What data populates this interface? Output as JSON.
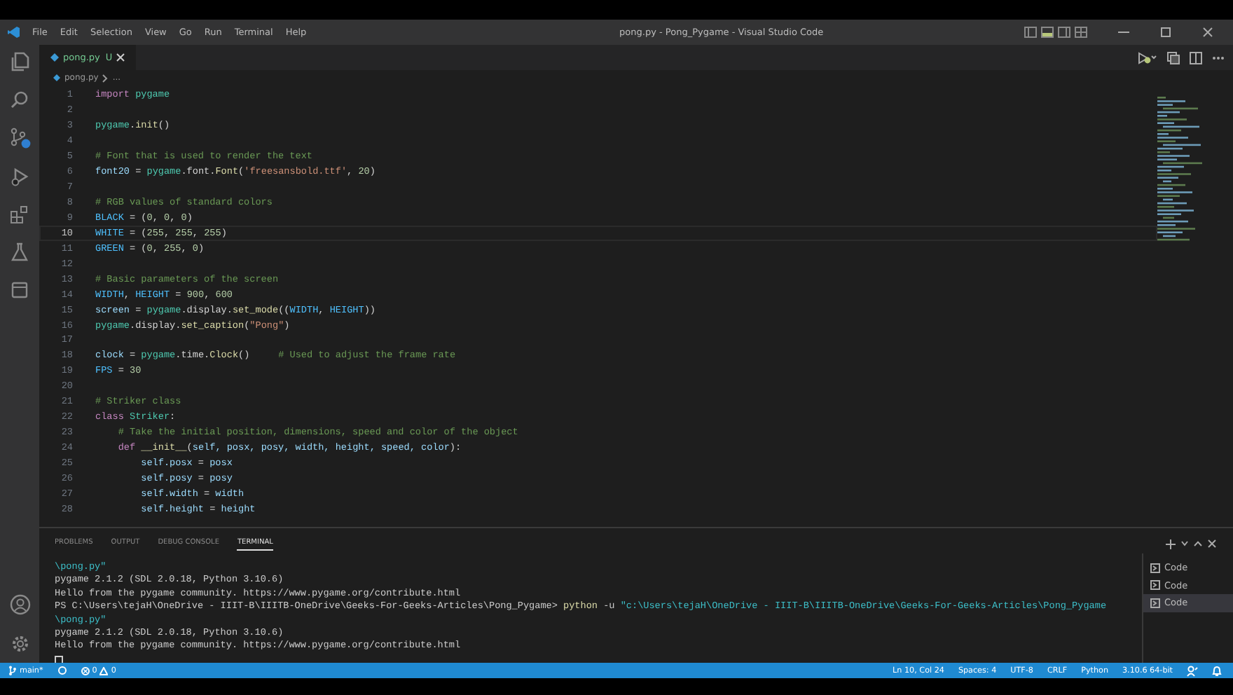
{
  "window": {
    "title": "pong.py - Pong_Pygame - Visual Studio Code"
  },
  "menu": [
    "File",
    "Edit",
    "Selection",
    "View",
    "Go",
    "Run",
    "Terminal",
    "Help"
  ],
  "editor_tabs": [
    {
      "label": "pong.py",
      "badge": "U",
      "selected": true
    }
  ],
  "breadcrumb": [
    "pong.py",
    "..."
  ],
  "code_lines": [
    {
      "number": "1",
      "current": false,
      "segments": [
        {
          "kind": "keyword",
          "text": "import "
        },
        {
          "kind": "module",
          "text": "pygame"
        }
      ]
    },
    {
      "number": "2",
      "current": false
    },
    {
      "number": "3",
      "current": false,
      "segments": [
        {
          "kind": "module",
          "text": "pygame"
        },
        {
          "kind": "plain",
          "text": "."
        },
        {
          "kind": "function",
          "text": "init"
        },
        {
          "kind": "plain",
          "text": "()"
        }
      ]
    },
    {
      "number": "4",
      "current": false
    },
    {
      "number": "5",
      "current": false,
      "segments": [
        {
          "kind": "comment",
          "text": "# Font that is used to render the text"
        }
      ]
    },
    {
      "number": "6",
      "current": false,
      "segments": [
        {
          "kind": "variable",
          "text": "font20"
        },
        {
          "kind": "plain",
          "text": " = "
        },
        {
          "kind": "module",
          "text": "pygame"
        },
        {
          "kind": "plain",
          "text": ".font."
        },
        {
          "kind": "function",
          "text": "Font"
        },
        {
          "kind": "plain",
          "text": "("
        },
        {
          "kind": "string",
          "text": "'freesansbold.ttf'"
        },
        {
          "kind": "plain",
          "text": ", "
        },
        {
          "kind": "number",
          "text": "20"
        },
        {
          "kind": "plain",
          "text": ")"
        }
      ]
    },
    {
      "number": "7",
      "current": false
    },
    {
      "number": "8",
      "current": false,
      "segments": [
        {
          "kind": "comment",
          "text": "# RGB values of standard colors"
        }
      ]
    },
    {
      "number": "9",
      "current": false,
      "segments": [
        {
          "kind": "constant",
          "text": "BLACK"
        },
        {
          "kind": "plain",
          "text": " = ("
        },
        {
          "kind": "number",
          "text": "0"
        },
        {
          "kind": "plain",
          "text": ", "
        },
        {
          "kind": "number",
          "text": "0"
        },
        {
          "kind": "plain",
          "text": ", "
        },
        {
          "kind": "number",
          "text": "0"
        },
        {
          "kind": "plain",
          "text": ")"
        }
      ]
    },
    {
      "number": "10",
      "current": true,
      "segments": [
        {
          "kind": "constant",
          "text": "WHITE"
        },
        {
          "kind": "plain",
          "text": " = ("
        },
        {
          "kind": "number",
          "text": "255"
        },
        {
          "kind": "plain",
          "text": ", "
        },
        {
          "kind": "number",
          "text": "255"
        },
        {
          "kind": "plain",
          "text": ", "
        },
        {
          "kind": "number",
          "text": "255"
        },
        {
          "kind": "plain",
          "text": ")"
        }
      ]
    },
    {
      "number": "11",
      "current": false,
      "segments": [
        {
          "kind": "constant",
          "text": "GREEN"
        },
        {
          "kind": "plain",
          "text": " = ("
        },
        {
          "kind": "number",
          "text": "0"
        },
        {
          "kind": "plain",
          "text": ", "
        },
        {
          "kind": "number",
          "text": "255"
        },
        {
          "kind": "plain",
          "text": ", "
        },
        {
          "kind": "number",
          "text": "0"
        },
        {
          "kind": "plain",
          "text": ")"
        }
      ]
    },
    {
      "number": "12",
      "current": false
    },
    {
      "number": "13",
      "current": false,
      "segments": [
        {
          "kind": "comment",
          "text": "# Basic parameters of the screen"
        }
      ]
    },
    {
      "number": "14",
      "current": false,
      "segments": [
        {
          "kind": "constant",
          "text": "WIDTH"
        },
        {
          "kind": "plain",
          "text": ", "
        },
        {
          "kind": "constant",
          "text": "HEIGHT"
        },
        {
          "kind": "plain",
          "text": " = "
        },
        {
          "kind": "number",
          "text": "900"
        },
        {
          "kind": "plain",
          "text": ", "
        },
        {
          "kind": "number",
          "text": "600"
        }
      ]
    },
    {
      "number": "15",
      "current": false,
      "segments": [
        {
          "kind": "variable",
          "text": "screen"
        },
        {
          "kind": "plain",
          "text": " = "
        },
        {
          "kind": "module",
          "text": "pygame"
        },
        {
          "kind": "plain",
          "text": ".display."
        },
        {
          "kind": "function",
          "text": "set_mode"
        },
        {
          "kind": "plain",
          "text": "(("
        },
        {
          "kind": "constant",
          "text": "WIDTH"
        },
        {
          "kind": "plain",
          "text": ", "
        },
        {
          "kind": "constant",
          "text": "HEIGHT"
        },
        {
          "kind": "plain",
          "text": "))"
        }
      ]
    },
    {
      "number": "16",
      "current": false,
      "segments": [
        {
          "kind": "module",
          "text": "pygame"
        },
        {
          "kind": "plain",
          "text": ".display."
        },
        {
          "kind": "function",
          "text": "set_caption"
        },
        {
          "kind": "plain",
          "text": "("
        },
        {
          "kind": "string",
          "text": "\"Pong\""
        },
        {
          "kind": "plain",
          "text": ")"
        }
      ]
    },
    {
      "number": "17",
      "current": false
    },
    {
      "number": "18",
      "current": false,
      "segments": [
        {
          "kind": "variable",
          "text": "clock"
        },
        {
          "kind": "plain",
          "text": " = "
        },
        {
          "kind": "module",
          "text": "pygame"
        },
        {
          "kind": "plain",
          "text": ".time."
        },
        {
          "kind": "function",
          "text": "Clock"
        },
        {
          "kind": "plain",
          "text": "()     "
        },
        {
          "kind": "comment",
          "text": "# Used to adjust the frame rate"
        }
      ]
    },
    {
      "number": "19",
      "current": false,
      "segments": [
        {
          "kind": "constant",
          "text": "FPS"
        },
        {
          "kind": "plain",
          "text": " = "
        },
        {
          "kind": "number",
          "text": "30"
        }
      ]
    },
    {
      "number": "20",
      "current": false
    },
    {
      "number": "21",
      "current": false,
      "segments": [
        {
          "kind": "comment",
          "text": "# Striker class"
        }
      ]
    },
    {
      "number": "22",
      "current": false,
      "segments": [
        {
          "kind": "keyword",
          "text": "class "
        },
        {
          "kind": "module",
          "text": "Striker"
        },
        {
          "kind": "plain",
          "text": ":"
        }
      ]
    },
    {
      "number": "23",
      "current": false,
      "segments": [
        {
          "kind": "comment",
          "text": "    # Take the initial position, dimensions, speed and color of the object"
        }
      ]
    },
    {
      "number": "24",
      "current": false,
      "segments": [
        {
          "kind": "keyword",
          "text": "    def "
        },
        {
          "kind": "function",
          "text": "__init__"
        },
        {
          "kind": "plain",
          "text": "("
        },
        {
          "kind": "variable",
          "text": "self, posx, posy, width, height, speed, color"
        },
        {
          "kind": "plain",
          "text": "):"
        }
      ]
    },
    {
      "number": "25",
      "current": false,
      "segments": [
        {
          "kind": "variable",
          "text": "        self.posx"
        },
        {
          "kind": "plain",
          "text": " = "
        },
        {
          "kind": "variable",
          "text": "posx"
        }
      ]
    },
    {
      "number": "26",
      "current": false,
      "segments": [
        {
          "kind": "variable",
          "text": "        self.posy"
        },
        {
          "kind": "plain",
          "text": " = "
        },
        {
          "kind": "variable",
          "text": "posy"
        }
      ]
    },
    {
      "number": "27",
      "current": false,
      "segments": [
        {
          "kind": "variable",
          "text": "        self.width"
        },
        {
          "kind": "plain",
          "text": " = "
        },
        {
          "kind": "variable",
          "text": "width"
        }
      ]
    },
    {
      "number": "28",
      "current": false,
      "segments": [
        {
          "kind": "variable",
          "text": "        self.height"
        },
        {
          "kind": "plain",
          "text": " = "
        },
        {
          "kind": "variable",
          "text": "height"
        }
      ]
    }
  ],
  "panel_tabs": [
    {
      "label": "PROBLEMS",
      "selected": false
    },
    {
      "label": "OUTPUT",
      "selected": false
    },
    {
      "label": "DEBUG CONSOLE",
      "selected": false
    },
    {
      "label": "TERMINAL",
      "selected": true
    }
  ],
  "terminal_lines": [
    {
      "segments": [
        {
          "kind": "path",
          "text": "\\pong.py\""
        }
      ]
    },
    {
      "segments": [
        {
          "kind": "plain",
          "text": "pygame 2.1.2 (SDL 2.0.18, Python 3.10.6)"
        }
      ]
    },
    {
      "segments": [
        {
          "kind": "plain",
          "text": "Hello from the pygame community. https://www.pygame.org/contribute.html"
        }
      ]
    },
    {
      "segments": [
        {
          "kind": "plain",
          "text": "PS C:\\Users\\tejaH\\OneDrive - IIIT-B\\IIITB-OneDrive\\Geeks-For-Geeks-Articles\\Pong_Pygame> "
        },
        {
          "kind": "command",
          "text": "python"
        },
        {
          "kind": "plain",
          "text": " -u "
        },
        {
          "kind": "path",
          "text": "\"c:\\Users\\tejaH\\OneDrive - IIIT-B\\IIITB-OneDrive\\Geeks-For-Geeks-Articles\\Pong_Pygame"
        }
      ]
    },
    {
      "segments": [
        {
          "kind": "path",
          "text": "\\pong.py\""
        }
      ]
    },
    {
      "segments": [
        {
          "kind": "plain",
          "text": "pygame 2.1.2 (SDL 2.0.18, Python 3.10.6)"
        }
      ]
    },
    {
      "segments": [
        {
          "kind": "plain",
          "text": "Hello from the pygame community. https://www.pygame.org/contribute.html"
        }
      ]
    }
  ],
  "terminals": [
    {
      "label": "Code",
      "selected": false
    },
    {
      "label": "Code",
      "selected": false
    },
    {
      "label": "Code",
      "selected": true
    }
  ],
  "status_bar": {
    "branch": "main*",
    "errors": "0",
    "warnings": "0",
    "right": [
      "Ln 10, Col 24",
      "Spaces: 4",
      "UTF-8",
      "CRLF",
      "Python",
      "3.10.6 64-bit"
    ]
  }
}
